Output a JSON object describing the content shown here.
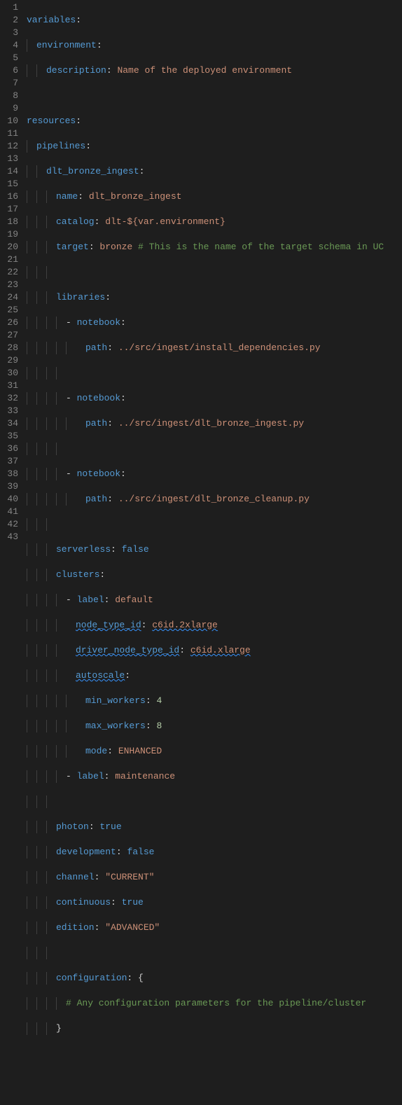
{
  "gutter_numbers": [
    "1",
    "2",
    "3",
    "4",
    "5",
    "6",
    "7",
    "8",
    "9",
    "10",
    "11",
    "12",
    "13",
    "14",
    "15",
    "16",
    "17",
    "18",
    "19",
    "20",
    "21",
    "22",
    "23",
    "24",
    "25",
    "26",
    "27",
    "28",
    "29",
    "30",
    "31",
    "32",
    "33",
    "34",
    "35",
    "36",
    "37",
    "38",
    "39",
    "40",
    "41",
    "42",
    "43"
  ],
  "colors": {
    "bg": "#1e1e1e",
    "gutter": "#858585",
    "key": "#569cd6",
    "string": "#ce9178",
    "number": "#b5cea8",
    "comment": "#6a9955",
    "plain": "#d4d4d4"
  },
  "tokens": {
    "variables": "variables",
    "environment": "environment",
    "description": "description",
    "desc_val": "Name of the deployed environment",
    "resources": "resources",
    "pipelines": "pipelines",
    "dlt_bronze_ingest_key": "dlt_bronze_ingest",
    "name": "name",
    "name_val": "dlt_bronze_ingest",
    "catalog": "catalog",
    "catalog_val": "dlt-${var.environment}",
    "target": "target",
    "target_val": "bronze",
    "target_comment": "# This is the name of the target schema in UC",
    "libraries": "libraries",
    "notebook": "notebook",
    "path": "path",
    "path1": "../src/ingest/install_dependencies.py",
    "path2": "../src/ingest/dlt_bronze_ingest.py",
    "path3": "../src/ingest/dlt_bronze_cleanup.py",
    "serverless": "serverless",
    "false": "false",
    "true": "true",
    "clusters": "clusters",
    "label": "label",
    "default": "default",
    "maintenance": "maintenance",
    "node_type_id": "node_type_id",
    "node_type_val": "c6id.2xlarge",
    "driver_node_type_id": "driver_node_type_id",
    "driver_node_type_val": "c6id.xlarge",
    "autoscale": "autoscale",
    "min_workers": "min_workers",
    "min_workers_val": "4",
    "max_workers": "max_workers",
    "max_workers_val": "8",
    "mode": "mode",
    "mode_val": "ENHANCED",
    "photon": "photon",
    "development": "development",
    "channel": "channel",
    "channel_val": "\"CURRENT\"",
    "continuous": "continuous",
    "edition": "edition",
    "edition_val": "\"ADVANCED\"",
    "configuration": "configuration",
    "open_brace": "{",
    "close_brace": "}",
    "config_comment": "# Any configuration parameters for the pipeline/cluster",
    "dash": "- ",
    "colon": ":",
    "colon_sp": ": "
  }
}
